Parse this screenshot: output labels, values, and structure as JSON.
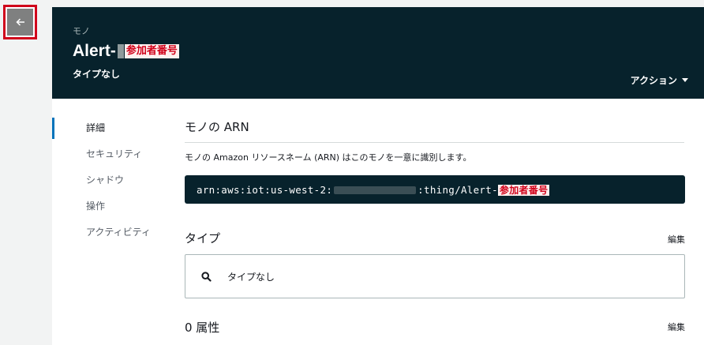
{
  "nav": {
    "back_icon": "arrow-left-icon"
  },
  "header": {
    "breadcrumb": "モノ",
    "title_prefix": "Alert-",
    "title_tag": "参加者番号",
    "subtitle": "タイプなし",
    "actions_label": "アクション"
  },
  "sidebar": {
    "items": [
      {
        "label": "詳細",
        "active": true
      },
      {
        "label": "セキュリティ",
        "active": false
      },
      {
        "label": "シャドウ",
        "active": false
      },
      {
        "label": "操作",
        "active": false
      },
      {
        "label": "アクティビティ",
        "active": false
      }
    ]
  },
  "arn_section": {
    "title": "モノの ARN",
    "description": "モノの Amazon リソースネーム (ARN) はこのモノを一意に識別します。",
    "arn_prefix": "arn:aws:iot:us-west-2:",
    "arn_suffix": ":thing/Alert-",
    "arn_tag": "参加者番号"
  },
  "type_section": {
    "title": "タイプ",
    "edit_label": "編集",
    "value": "タイプなし"
  },
  "attributes_section": {
    "title": "0 属性",
    "edit_label": "編集"
  },
  "colors": {
    "header_bg": "#07222c",
    "highlight_red": "#d0021b",
    "active_indicator": "#0073bb"
  }
}
